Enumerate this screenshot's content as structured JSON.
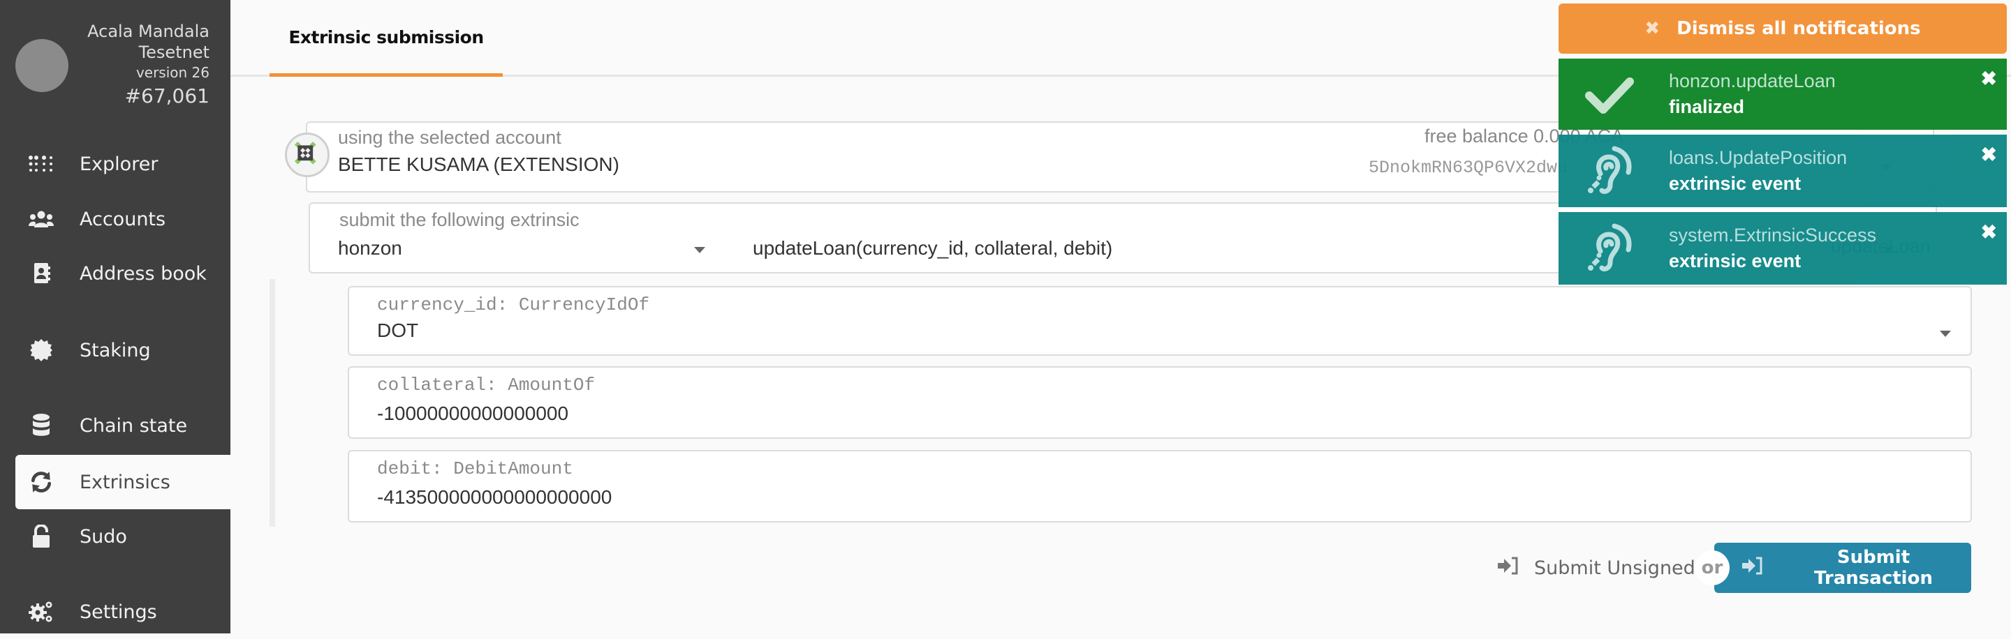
{
  "chain": {
    "name_line1": "Acala Mandala",
    "name_line2": "Tesetnet",
    "version": "version 26",
    "block": "#67,061"
  },
  "sidebar": {
    "items": [
      {
        "label": "Explorer",
        "icon": "explorer-dots-icon"
      },
      {
        "label": "Accounts",
        "icon": "users-icon"
      },
      {
        "label": "Address book",
        "icon": "address-book-icon"
      },
      {
        "label": "Staking",
        "icon": "certificate-icon"
      },
      {
        "label": "Chain state",
        "icon": "database-icon"
      },
      {
        "label": "Extrinsics",
        "icon": "sync-icon",
        "active": true
      },
      {
        "label": "Sudo",
        "icon": "unlock-icon"
      },
      {
        "label": "Settings",
        "icon": "cogs-icon"
      }
    ]
  },
  "tabs": [
    {
      "label": "Extrinsic submission",
      "active": true
    }
  ],
  "account": {
    "label": "using the selected account",
    "value": "BETTE KUSAMA (EXTENSION)",
    "address_visible": "5DnokmRN63QP6VX2dwu",
    "balance": "free balance 0.000 ACA"
  },
  "extrinsic": {
    "label": "submit the following extrinsic",
    "section": "honzon",
    "method": "updateLoan(currency_id, collateral, debit)",
    "method_short": "updateLoan"
  },
  "params": [
    {
      "label": "currency_id: CurrencyIdOf",
      "value": "DOT",
      "type": "dropdown"
    },
    {
      "label": "collateral: AmountOf",
      "value": "-10000000000000000",
      "type": "input"
    },
    {
      "label": "debit: DebitAmount",
      "value": "-413500000000000000000",
      "type": "input"
    }
  ],
  "actions": {
    "submit_unsigned": "Submit Unsigned",
    "or": "or",
    "submit_transaction": "Submit Transaction"
  },
  "notifications": {
    "dismiss_all": "Dismiss all notifications",
    "items": [
      {
        "title": "honzon.updateLoan",
        "status": "finalized",
        "icon": "check-icon",
        "color": "#0e8527"
      },
      {
        "title": "loans.UpdatePosition",
        "status": "extrinsic event",
        "icon": "ear-listen-icon",
        "color": "#0f8787"
      },
      {
        "title": "system.ExtrinsicSuccess",
        "status": "extrinsic event",
        "icon": "ear-listen-icon",
        "color": "#0f8787"
      }
    ]
  },
  "colors": {
    "sidebar_bg": "#3f3f3f",
    "accent_orange": "#f19135",
    "submit_blue": "#2687a8",
    "success_green": "#0e8527",
    "event_teal": "#0f8787"
  }
}
